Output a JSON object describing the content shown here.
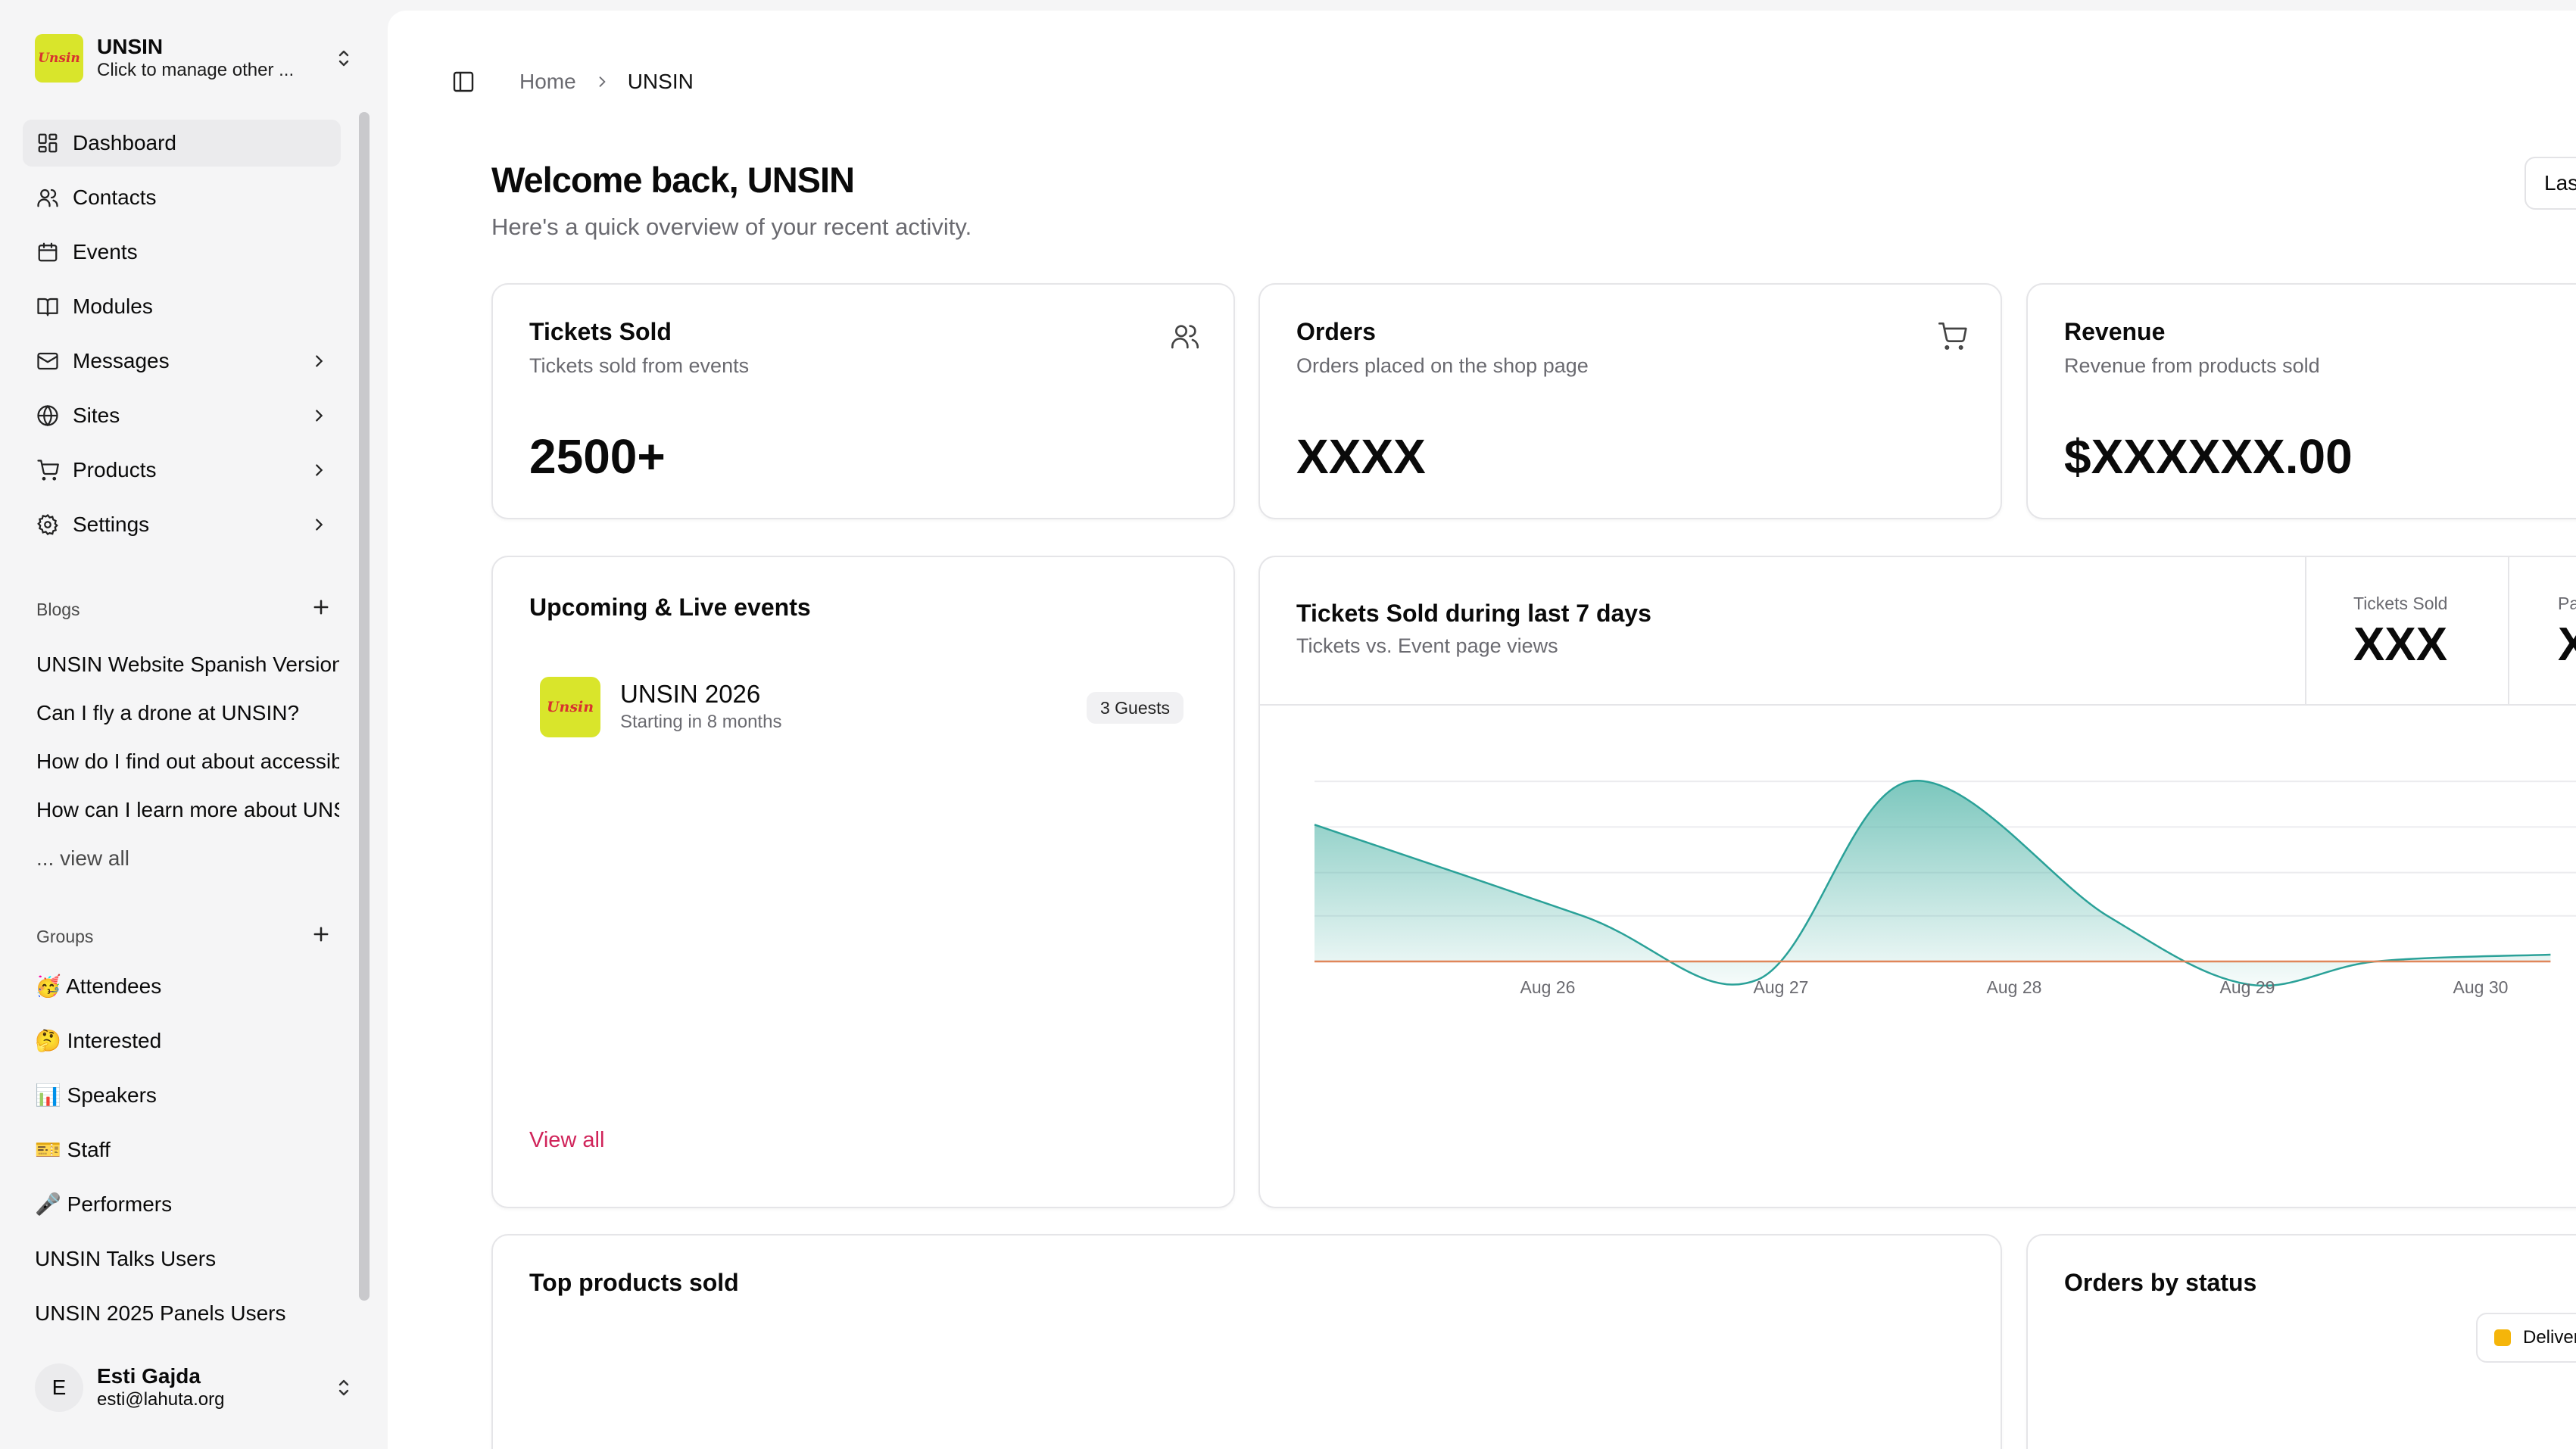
{
  "org": {
    "logo_text": "Unsin",
    "name": "UNSIN",
    "subtitle": "Click to manage other ..."
  },
  "nav": [
    {
      "label": "Dashboard",
      "icon": "dashboard-icon",
      "active": true,
      "chevron": false
    },
    {
      "label": "Contacts",
      "icon": "users-icon",
      "active": false,
      "chevron": false
    },
    {
      "label": "Events",
      "icon": "calendar-icon",
      "active": false,
      "chevron": false
    },
    {
      "label": "Modules",
      "icon": "book-icon",
      "active": false,
      "chevron": false
    },
    {
      "label": "Messages",
      "icon": "mail-icon",
      "active": false,
      "chevron": true
    },
    {
      "label": "Sites",
      "icon": "globe-icon",
      "active": false,
      "chevron": true
    },
    {
      "label": "Products",
      "icon": "cart-icon",
      "active": false,
      "chevron": true
    },
    {
      "label": "Settings",
      "icon": "gear-icon",
      "active": false,
      "chevron": true
    }
  ],
  "blogs": {
    "heading": "Blogs",
    "items": [
      "UNSIN Website Spanish Version",
      "Can I fly a drone at UNSIN?",
      "How do I find out about accessibility",
      "How can I learn more about UNSIN"
    ],
    "view_all": "... view all"
  },
  "groups": {
    "heading": "Groups",
    "items": [
      "🥳 Attendees",
      "🤔 Interested",
      "📊 Speakers",
      "🎫 Staff",
      "🎤 Performers",
      "UNSIN Talks Users",
      "UNSIN 2025 Panels Users"
    ]
  },
  "user": {
    "initial": "E",
    "name": "Esti Gajda",
    "email": "esti@lahuta.org"
  },
  "breadcrumb": {
    "home": "Home",
    "current": "UNSIN"
  },
  "header": {
    "welcome": "Welcome back, UNSIN",
    "subtitle": "Here's a quick overview of your recent activity.",
    "range_button": "Las"
  },
  "stats": [
    {
      "title": "Tickets Sold",
      "desc": "Tickets sold from events",
      "value": "2500+",
      "icon": "users-icon"
    },
    {
      "title": "Orders",
      "desc": "Orders placed on the shop page",
      "value": "XXXX",
      "icon": "cart-icon"
    },
    {
      "title": "Revenue",
      "desc": "Revenue from products sold",
      "value": "$XXXXXX.00",
      "icon": ""
    }
  ],
  "events": {
    "title": "Upcoming & Live events",
    "items": [
      {
        "logo_text": "Unsin",
        "name": "UNSIN 2026",
        "when": "Starting in 8 months",
        "badge": "3 Guests"
      }
    ],
    "view_all": "View all"
  },
  "tickets_chart": {
    "title": "Tickets Sold during last 7 days",
    "subtitle": "Tickets vs. Event page views",
    "stat1_label": "Tickets Sold",
    "stat1_value": "XXX",
    "stat2_label": "Pag",
    "stat2_value": "X"
  },
  "chart_data": {
    "type": "area",
    "title": "Tickets Sold during last 7 days",
    "x_ticks": [
      "Aug 26",
      "Aug 27",
      "Aug 28",
      "Aug 29",
      "Aug 30"
    ],
    "series": [
      {
        "name": "",
        "color": "#2aa198",
        "x": [
          0,
          1.15,
          1.9,
          2.55,
          3.4,
          4.0,
          4.55,
          5.3
        ],
        "values": [
          60,
          20,
          -8,
          79,
          20,
          -10,
          0,
          3
        ]
      },
      {
        "name": "",
        "color": "#e0865a",
        "x": [
          0,
          5.3
        ],
        "values": [
          0,
          0
        ]
      }
    ],
    "ylim": [
      -12,
      95
    ],
    "grid": true
  },
  "bottom": {
    "top_products_title": "Top products sold",
    "orders_status_title": "Orders by status",
    "legend_label": "Deliver",
    "legend_color": "#f5b50a"
  }
}
